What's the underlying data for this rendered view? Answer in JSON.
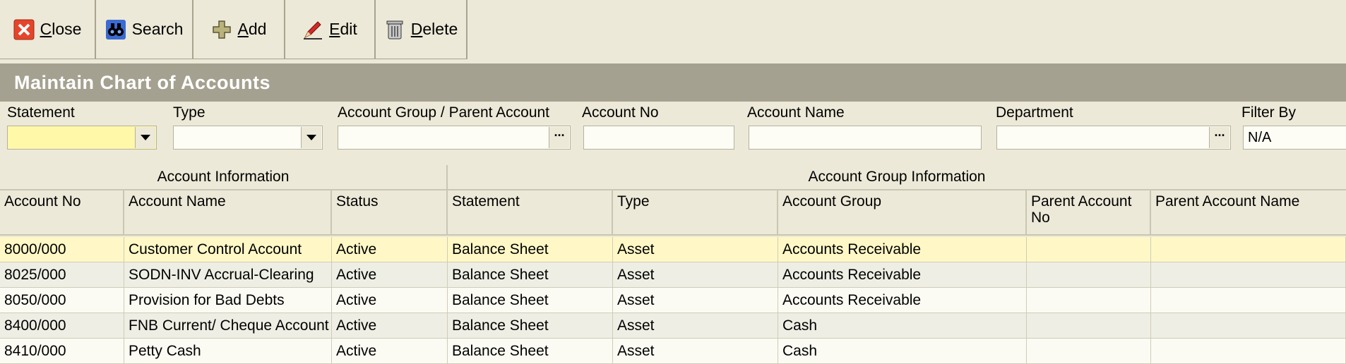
{
  "toolbar": {
    "close": {
      "pre": "",
      "accel": "C",
      "rest": "lose"
    },
    "search": {
      "label": "Search"
    },
    "add": {
      "pre": "",
      "accel": "A",
      "rest": "dd"
    },
    "edit": {
      "pre": "",
      "accel": "E",
      "rest": "dit"
    },
    "delete": {
      "pre": "",
      "accel": "D",
      "rest": "elete"
    }
  },
  "title": "Maintain Chart of Accounts",
  "filters": {
    "statement": {
      "label": "Statement",
      "value": ""
    },
    "type": {
      "label": "Type",
      "value": ""
    },
    "group": {
      "label": "Account Group / Parent Account",
      "value": ""
    },
    "account_no": {
      "label": "Account No",
      "value": ""
    },
    "account_name": {
      "label": "Account Name",
      "value": ""
    },
    "department": {
      "label": "Department",
      "value": ""
    },
    "filter_by": {
      "label": "Filter By",
      "value": "N/A"
    }
  },
  "grid": {
    "groups": [
      "Account Information",
      "Account Group Information"
    ],
    "columns": [
      "Account No",
      "Account Name",
      "Status",
      "Statement",
      "Type",
      "Account Group",
      "Parent Account No",
      "Parent Account Name"
    ],
    "rows": [
      [
        "8000/000",
        "Customer Control Account",
        "Active",
        "Balance Sheet",
        "Asset",
        "Accounts Receivable",
        "",
        ""
      ],
      [
        "8025/000",
        "SODN-INV Accrual-Clearing",
        "Active",
        "Balance Sheet",
        "Asset",
        "Accounts Receivable",
        "",
        ""
      ],
      [
        "8050/000",
        "Provision for Bad Debts",
        "Active",
        "Balance Sheet",
        "Asset",
        "Accounts Receivable",
        "",
        ""
      ],
      [
        "8400/000",
        "FNB Current/ Cheque Account",
        "Active",
        "Balance Sheet",
        "Asset",
        "Cash",
        "",
        ""
      ],
      [
        "8410/000",
        "Petty Cash",
        "Active",
        "Balance Sheet",
        "Asset",
        "Cash",
        "",
        ""
      ]
    ],
    "selected_row": 0
  },
  "colors": {
    "selected": "#fff8c6",
    "odd": "#fcfbf3",
    "even": "#eeeee4",
    "title_bar": "#a5a190"
  }
}
